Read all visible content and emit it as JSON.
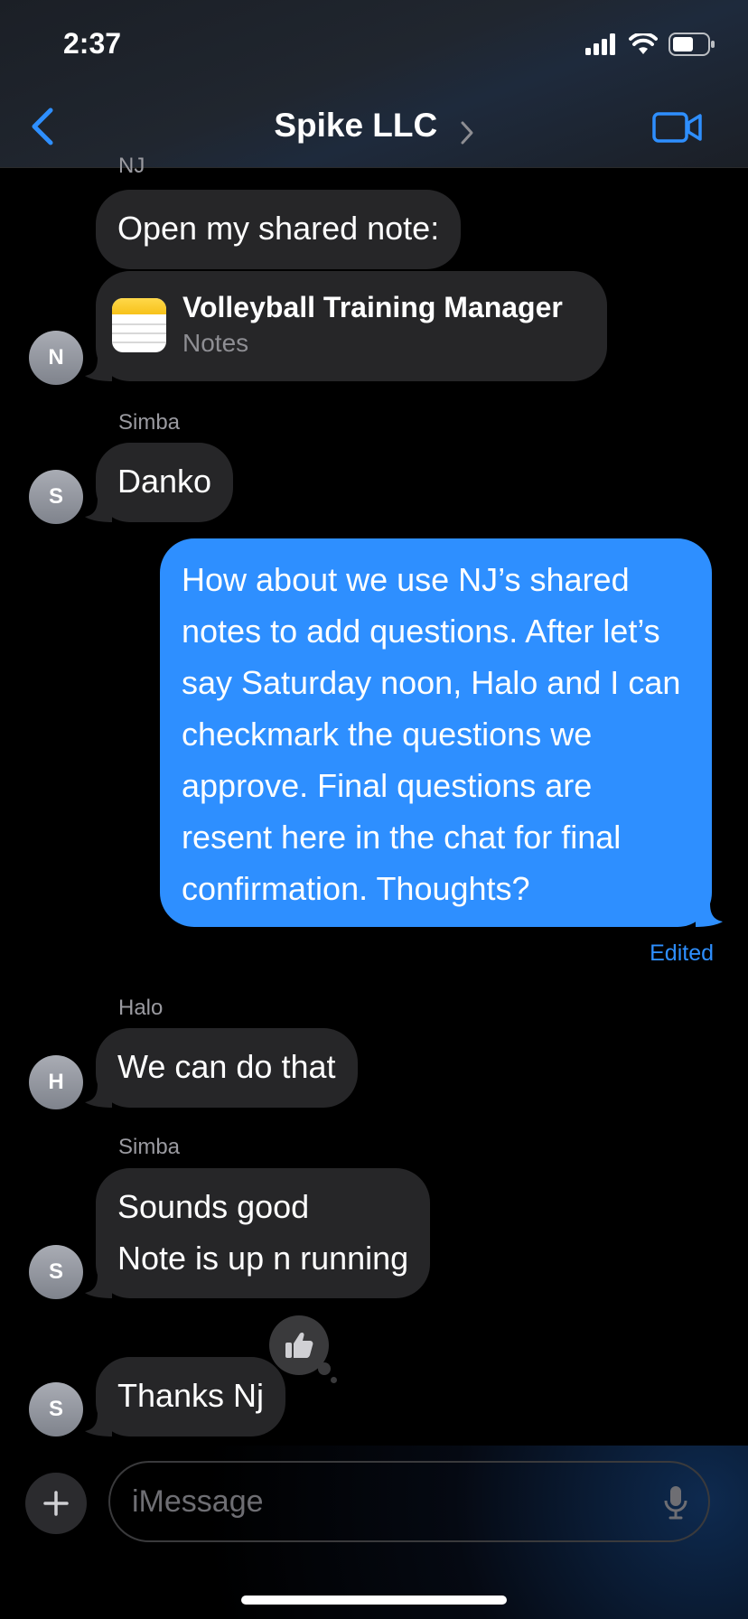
{
  "status_bar": {
    "time": "2:37"
  },
  "header": {
    "title": "Spike LLC"
  },
  "messages": [
    {
      "sender": "NJ",
      "avatar": "N",
      "text": "Open my shared note:",
      "attachment": {
        "title": "Volleyball Training Manager",
        "subtitle": "Notes"
      }
    },
    {
      "sender": "Simba",
      "avatar": "S",
      "text": "Danko"
    },
    {
      "text": "How about we use NJ’s shared notes to add questions. After let’s say Saturday noon, Halo and I can checkmark the questions we approve. Final questions are resent here in the chat for final confirmation. Thoughts?",
      "status": "Edited"
    },
    {
      "sender": "Halo",
      "avatar": "H",
      "text": "We can do that"
    },
    {
      "sender": "Simba",
      "avatar": "S",
      "lines": [
        "Sounds good",
        "Note is up n running"
      ]
    },
    {
      "avatar": "S",
      "text": "Thanks Nj",
      "reaction": "thumbs-up"
    }
  ],
  "composer": {
    "placeholder": "iMessage"
  },
  "colors": {
    "outgoing": "#2e8fff",
    "incoming": "#262628",
    "accent": "#2e8fff"
  }
}
